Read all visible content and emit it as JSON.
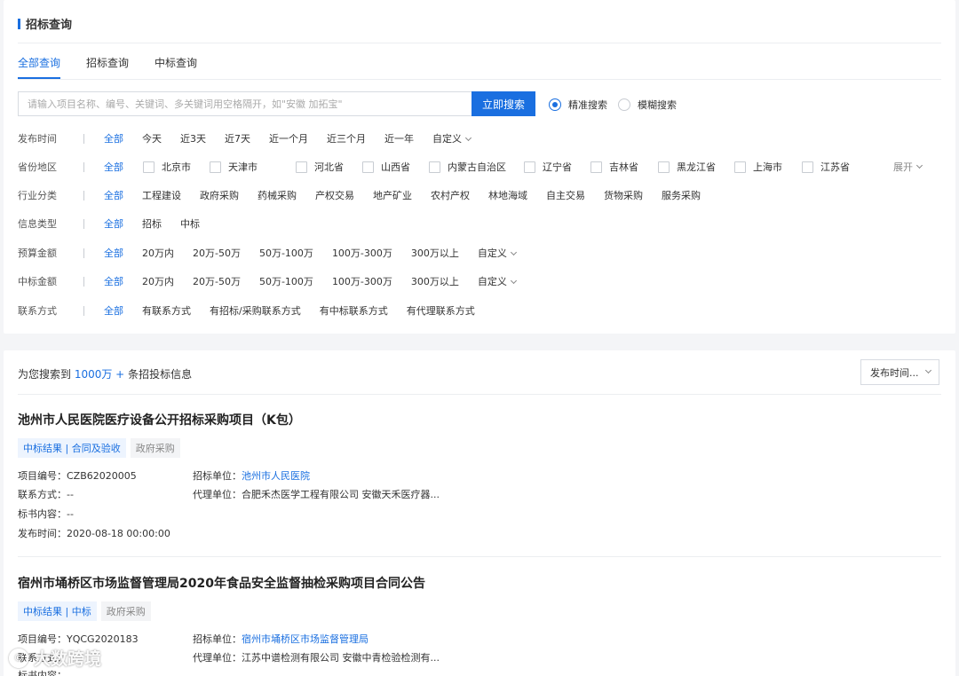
{
  "filter_panel": {
    "title": "招标查询",
    "tabs": [
      "全部查询",
      "招标查询",
      "中标查询"
    ],
    "search": {
      "placeholder": "请输入项目名称、编号、关键词、多关键词用空格隔开，如\"安徽 加拓宝\"",
      "button": "立即搜索"
    },
    "search_modes": [
      "精准搜索",
      "模糊搜索"
    ],
    "rows": {
      "publish_time": {
        "label": "发布时间",
        "options": [
          "全部",
          "今天",
          "近3天",
          "近7天",
          "近一个月",
          "近三个月",
          "近一年",
          "自定义"
        ]
      },
      "province": {
        "label": "省份地区",
        "options": [
          "全部",
          "北京市",
          "天津市",
          "河北省",
          "山西省",
          "内蒙古自治区",
          "辽宁省",
          "吉林省",
          "黑龙江省",
          "上海市",
          "江苏省"
        ],
        "expand": "展开"
      },
      "industry": {
        "label": "行业分类",
        "options": [
          "全部",
          "工程建设",
          "政府采购",
          "药械采购",
          "产权交易",
          "地产矿业",
          "农村产权",
          "林地海域",
          "自主交易",
          "货物采购",
          "服务采购"
        ]
      },
      "info_type": {
        "label": "信息类型",
        "options": [
          "全部",
          "招标",
          "中标"
        ]
      },
      "budget": {
        "label": "预算金额",
        "options": [
          "全部",
          "20万内",
          "20万-50万",
          "50万-100万",
          "100万-300万",
          "300万以上",
          "自定义"
        ]
      },
      "bid_amount": {
        "label": "中标金额",
        "options": [
          "全部",
          "20万内",
          "20万-50万",
          "50万-100万",
          "100万-300万",
          "300万以上",
          "自定义"
        ]
      },
      "contact": {
        "label": "联系方式",
        "options": [
          "全部",
          "有联系方式",
          "有招标/采购联系方式",
          "有中标联系方式",
          "有代理联系方式"
        ]
      }
    }
  },
  "results": {
    "prefix": "为您搜索到 ",
    "count": "1000万 +",
    "suffix": " 条招投标信息",
    "sort_label": "发布时间...",
    "items": [
      {
        "title": "池州市人民医院医疗设备公开招标采购项目（K包）",
        "tags": [
          "中标结果 | 合同及验收",
          "政府采购"
        ],
        "project_no": "项目编号：CZB62020005",
        "contact": "联系方式：--",
        "content": "标书内容：--",
        "publish": "发布时间：2020-08-18 00:00:00",
        "tenderer_label": "招标单位：",
        "tenderer": "池州市人民医院",
        "agent": "代理单位：合肥禾杰医学工程有限公司 安徽天禾医疗器..."
      },
      {
        "title": "宿州市埇桥区市场监督管理局2020年食品安全监督抽检采购项目合同公告",
        "tags": [
          "中标结果 | 中标",
          "政府采购"
        ],
        "project_no": "项目编号：YQCG2020183",
        "contact": "联系方式：",
        "content": "标书内容：",
        "publish": "",
        "tenderer_label": "招标单位：",
        "tenderer": "宿州市埇桥区市场监督管理局",
        "agent": "代理单位：江苏中谱检测有限公司 安徽中青检验检测有..."
      }
    ]
  },
  "watermark": "大数跨境"
}
